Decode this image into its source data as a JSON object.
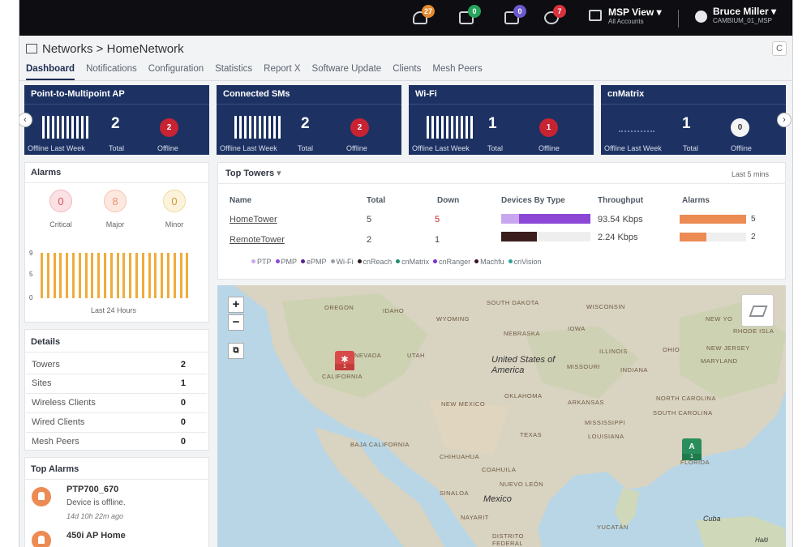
{
  "topbar": {
    "alerts": [
      {
        "icon": "alarm-bell-icon",
        "badge": "27",
        "color": "#e58a2d"
      },
      {
        "icon": "device-online-icon",
        "badge": "0",
        "color": "#27a35a"
      },
      {
        "icon": "device-pending-icon",
        "badge": "0",
        "color": "#6a5acd"
      },
      {
        "icon": "device-offline-icon",
        "badge": "7",
        "color": "#d8323c"
      }
    ],
    "msp_view": {
      "title": "MSP View",
      "subtitle": "All Accounts"
    },
    "user": {
      "name": "Bruce Miller",
      "account": "CAMBIUM_01_MSP"
    }
  },
  "breadcrumb": "Networks > HomeNetwork",
  "refresh_glyph": "C",
  "tabs": [
    "Dashboard",
    "Notifications",
    "Configuration",
    "Statistics",
    "Report X",
    "Software Update",
    "Clients",
    "Mesh Peers"
  ],
  "summary_cards": [
    {
      "title": "Point-to-Multipoint AP",
      "total": "2",
      "offline": "2",
      "offline_color": "red",
      "labels": [
        "Offline Last Week",
        "Total",
        "Offline"
      ]
    },
    {
      "title": "Connected SMs",
      "total": "2",
      "offline": "2",
      "offline_color": "red",
      "labels": [
        "Offline Last Week",
        "Total",
        "Offline"
      ]
    },
    {
      "title": "Wi-Fi",
      "total": "1",
      "offline": "1",
      "offline_color": "red",
      "labels": [
        "Offline Last Week",
        "Total",
        "Offline"
      ]
    },
    {
      "title": "cnMatrix",
      "total": "1",
      "offline": "0",
      "offline_color": "white",
      "labels": [
        "Offline Last Week",
        "Total",
        "Offline"
      ]
    }
  ],
  "nav_arrows": {
    "left": "‹",
    "right": "›"
  },
  "alarms": {
    "title": "Alarms",
    "critical": {
      "value": "0",
      "label": "Critical"
    },
    "major": {
      "value": "8",
      "label": "Major"
    },
    "minor": {
      "value": "0",
      "label": "Minor"
    },
    "axis": [
      "9",
      "5",
      "0"
    ],
    "footer": "Last 24 Hours",
    "bar_color": "#efac3b"
  },
  "details": {
    "title": "Details",
    "rows": [
      {
        "label": "Towers",
        "value": "2"
      },
      {
        "label": "Sites",
        "value": "1"
      },
      {
        "label": "Wireless Clients",
        "value": "0"
      },
      {
        "label": "Wired Clients",
        "value": "0"
      },
      {
        "label": "Mesh Peers",
        "value": "0"
      }
    ]
  },
  "top_alarms": {
    "title": "Top Alarms",
    "items": [
      {
        "name": "PTP700_670",
        "desc": "Device is offline.",
        "time": "14d 10h 22m ago"
      },
      {
        "name": "450i AP Home",
        "desc": "",
        "time": ""
      }
    ]
  },
  "top_towers": {
    "title": "Top Towers",
    "range": "Last 5 mins",
    "headers": [
      "Name",
      "Total",
      "Down",
      "Devices By Type",
      "Throughput",
      "Alarms"
    ],
    "rows": [
      {
        "name": "HomeTower",
        "total": "5",
        "down": "5",
        "throughput": "93.54 Kbps",
        "alarms": "5",
        "device_bar": 1.0,
        "alarm_bar": 1.0
      },
      {
        "name": "RemoteTower",
        "total": "2",
        "down": "1",
        "throughput": "2.24 Kbps",
        "alarms": "2",
        "device_bar": 0.4,
        "alarm_bar": 0.4
      }
    ],
    "legend": [
      {
        "label": "PTP",
        "color": "#c9a7f0"
      },
      {
        "label": "PMP",
        "color": "#8d47d6"
      },
      {
        "label": "ePMP",
        "color": "#5b1f8e"
      },
      {
        "label": "Wi-Fi",
        "color": "#9a9ea6"
      },
      {
        "label": "cnReach",
        "color": "#2b1a1a"
      },
      {
        "label": "cnMatrix",
        "color": "#1f8f6b"
      },
      {
        "label": "cnRanger",
        "color": "#7b2fd1"
      },
      {
        "label": "Machfu",
        "color": "#3a1020"
      },
      {
        "label": "cnVision",
        "color": "#2aa5a0"
      }
    ]
  },
  "map": {
    "zoom_in": "+",
    "zoom_out": "−",
    "select": "⧉",
    "labels": [
      "OREGON",
      "IDAHO",
      "WYOMING",
      "SOUTH DAKOTA",
      "WISCONSIN",
      "NEBRASKA",
      "IOWA",
      "NEVADA",
      "UTAH",
      "ILLINOIS",
      "OHIO",
      "NEW JERSEY",
      "MARYLAND",
      "CALIFORNIA",
      "MISSOURI",
      "INDIANA",
      "OKLAHOMA",
      "ARKANSAS",
      "NORTH CAROLINA",
      "SOUTH CAROLINA",
      "NEW MEXICO",
      "MISSISSIPPI",
      "TEXAS",
      "LOUISIANA",
      "BAJA CALIFORNIA",
      "CHIHUAHUA",
      "COAHUILA",
      "NUEVO LEÓN",
      "SINALOA",
      "NAYARIT",
      "YUCATÁN",
      "DISTRITO FEDERAL",
      "FLORIDA",
      "NEW YO",
      "RHODE ISLA"
    ],
    "country_us": "United States of America",
    "country_mx": "Mexico",
    "cuba": "Cuba",
    "haiti": "Haiti",
    "pin_red": {
      "glyph": "✱",
      "count": "1"
    },
    "pin_green": {
      "glyph": "A",
      "count": "1"
    }
  }
}
